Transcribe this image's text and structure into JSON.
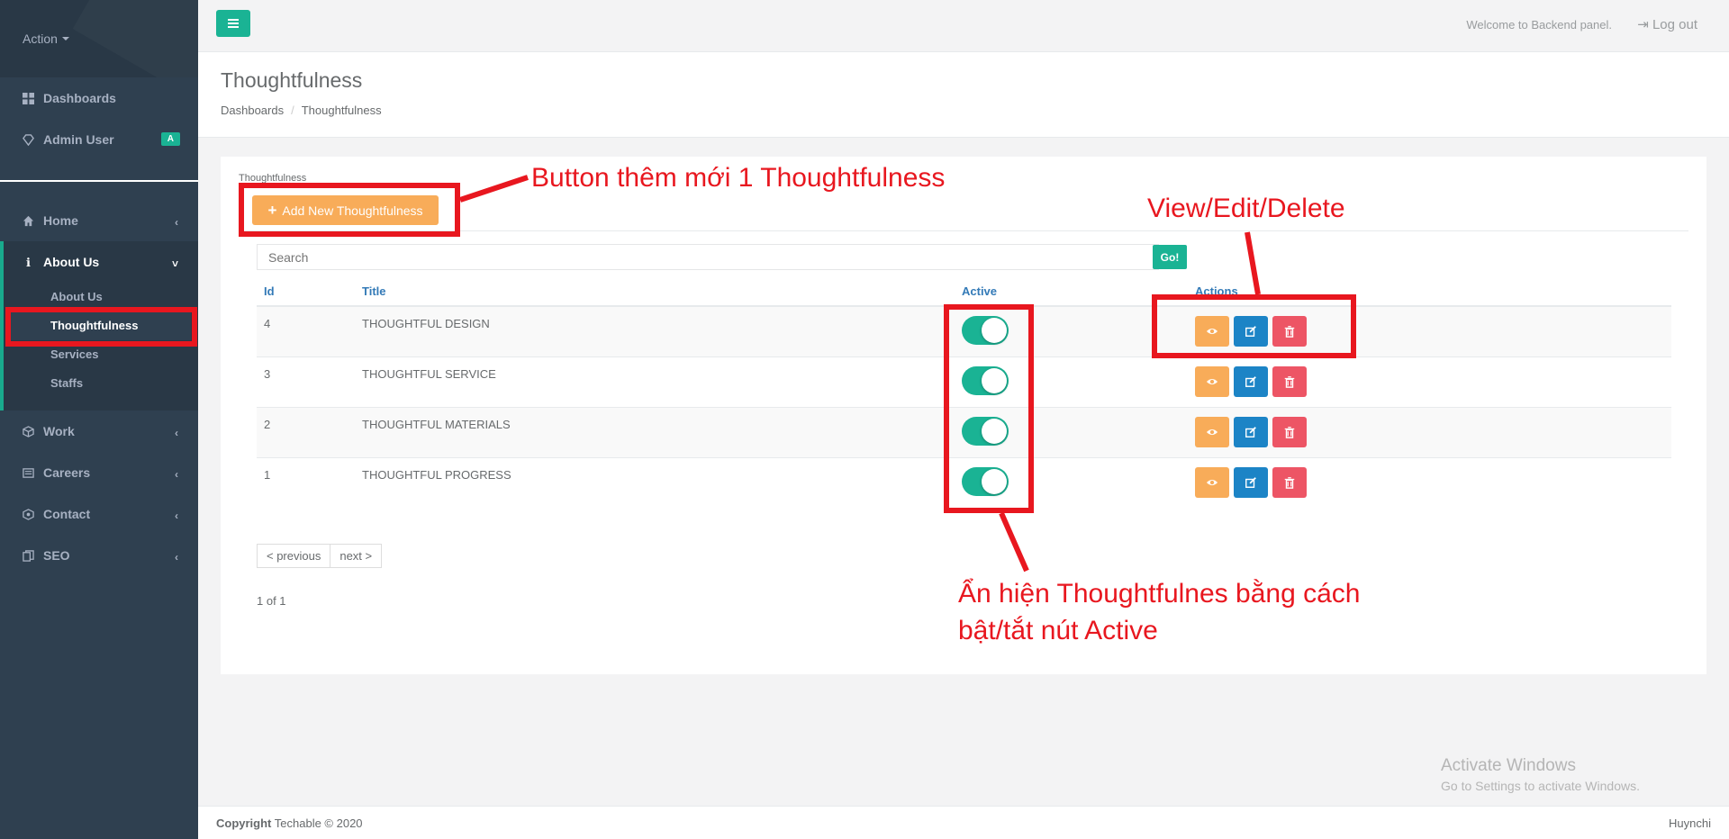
{
  "sidebar": {
    "profile_label": "Action",
    "nav": [
      {
        "label": "Dashboards"
      },
      {
        "label": "Admin User",
        "badge": "A"
      },
      {
        "label": "Home"
      },
      {
        "label": "About Us"
      },
      {
        "label": "Work"
      },
      {
        "label": "Careers"
      },
      {
        "label": "Contact"
      },
      {
        "label": "SEO"
      }
    ],
    "about_sub": [
      {
        "label": "About Us"
      },
      {
        "label": "Thoughtfulness"
      },
      {
        "label": "Services"
      },
      {
        "label": "Staffs"
      }
    ]
  },
  "topbar": {
    "welcome": "Welcome to Backend panel.",
    "logout": "Log out"
  },
  "heading": {
    "title": "Thoughtfulness",
    "breadcrumb": [
      "Dashboards",
      "Thoughtfulness"
    ]
  },
  "content": {
    "box_title": "Thoughtfulness",
    "add_button": "Add New Thoughtfulness",
    "search_placeholder": "Search",
    "go_button": "Go!",
    "columns": {
      "id": "Id",
      "title": "Title",
      "active": "Active",
      "actions": "Actions"
    },
    "rows": [
      {
        "id": "4",
        "title": "THOUGHTFUL DESIGN",
        "active": true
      },
      {
        "id": "3",
        "title": "THOUGHTFUL SERVICE",
        "active": true
      },
      {
        "id": "2",
        "title": "THOUGHTFUL MATERIALS",
        "active": true
      },
      {
        "id": "1",
        "title": "THOUGHTFUL PROGRESS",
        "active": true
      }
    ],
    "pager": {
      "prev": "< previous",
      "next": "next >",
      "info": "1 of 1"
    }
  },
  "footer": {
    "copyright_bold": "Copyright",
    "copyright_text": "Techable © 2020",
    "right": "Huynchi"
  },
  "watermark": {
    "line1": "Activate Windows",
    "line2": "Go to Settings to activate Windows."
  },
  "annotations": {
    "add_note": "Button thêm mới 1 Thoughtfulness",
    "actions_note": "View/Edit/Delete",
    "active_note_1": "Ẩn hiện Thoughtfulnes bằng cách",
    "active_note_2": "bật/tắt nút Active"
  },
  "colors": {
    "primary": "#1ab394",
    "sidebar": "#2f4050",
    "warning": "#f8ac59",
    "info": "#1c84c6",
    "danger": "#ed5565",
    "annotation": "#e8171f"
  }
}
